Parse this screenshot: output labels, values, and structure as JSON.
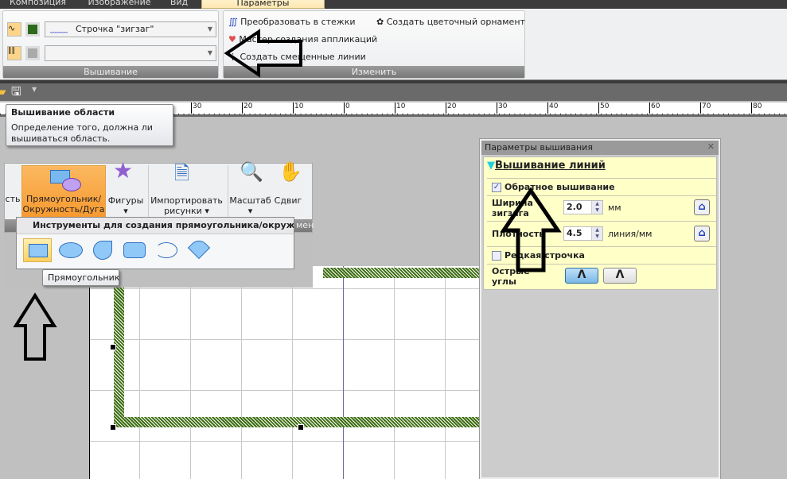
{
  "tabs": [
    {
      "label": "Композиция"
    },
    {
      "label": "Изображение"
    },
    {
      "label": "Вид"
    },
    {
      "label": "Параметры",
      "active": true
    }
  ],
  "ribbon": {
    "embroidery_group": {
      "label": "Вышивание",
      "line_combo": "Строчка \"зигзаг\"",
      "fill_combo": ""
    },
    "modify_group": {
      "label": "Изменить",
      "convert": "Преобразовать в стежки",
      "applique": "Мастер создания аппликаций",
      "offset": "Создать смещенные линии",
      "floral": "Создать цветочный орнамент"
    }
  },
  "tooltip": {
    "title": "Вышивание области",
    "text": "Определение того, должна ли вышиваться область."
  },
  "ruler": {
    "labels": [
      "30",
      "20",
      "10",
      "0",
      "10",
      "20",
      "30",
      "40",
      "50",
      "60",
      "70",
      "80"
    ]
  },
  "ribbon2": {
    "partial": "сть",
    "rect_btn": "Прямоугольник/ Окружность/Дуга",
    "shapes": "Фигуры",
    "import": "Импортировать рисунки",
    "zoom": "Масштаб",
    "pan": "Сдвиг",
    "partial_group": "мен"
  },
  "gallery": {
    "title": "Инструменты для создания прямоугольника/окружности/д",
    "items": [
      "rectangle",
      "ellipse",
      "pie",
      "rounded-rect",
      "arc",
      "fan"
    ],
    "tooltip": "Прямоугольник"
  },
  "panel": {
    "title": "Параметры вышивания",
    "section": "Вышивание линий",
    "reverse": {
      "label": "Обратное вышивание",
      "checked": true
    },
    "zigzag_width": {
      "label": "Ширина зигзага",
      "value": "2.0",
      "unit": "мм"
    },
    "density": {
      "label": "Плотность",
      "value": "4.5",
      "unit": "линия/мм"
    },
    "sparse": {
      "label": "Редкая строчка",
      "checked": false
    },
    "sharp_corners": {
      "label": "Острые углы"
    }
  },
  "colors": {
    "thread": "#3e6e14",
    "accent": "#f9a83e",
    "panel_bg": "#ffffc8"
  }
}
